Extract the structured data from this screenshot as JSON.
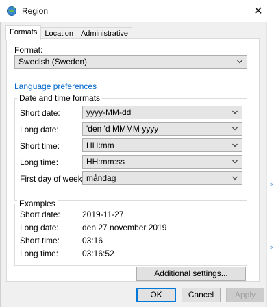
{
  "window": {
    "title": "Region",
    "close_glyph": "✕"
  },
  "tabs": [
    {
      "label": "Formats"
    },
    {
      "label": "Location"
    },
    {
      "label": "Administrative"
    }
  ],
  "format": {
    "label": "Format:",
    "value": "Swedish (Sweden)"
  },
  "language_link": "Language preferences",
  "date_time_formats": {
    "group_title": "Date and time formats",
    "short_date": {
      "label": "Short date:",
      "value": "yyyy-MM-dd"
    },
    "long_date": {
      "label": "Long date:",
      "value": "'den 'd MMMM yyyy"
    },
    "short_time": {
      "label": "Short time:",
      "value": "HH:mm"
    },
    "long_time": {
      "label": "Long time:",
      "value": "HH:mm:ss"
    },
    "first_day": {
      "label": "First day of week:",
      "value": "måndag"
    }
  },
  "examples": {
    "group_title": "Examples",
    "short_date": {
      "label": "Short date:",
      "value": "2019-11-27"
    },
    "long_date": {
      "label": "Long date:",
      "value": "den 27 november 2019"
    },
    "short_time": {
      "label": "Short time:",
      "value": "03:16"
    },
    "long_time": {
      "label": "Long time:",
      "value": "03:16:52"
    }
  },
  "buttons": {
    "additional_settings": "Additional settings...",
    "ok": "OK",
    "cancel": "Cancel",
    "apply": "Apply"
  },
  "icons": {
    "app": "region-globe-icon",
    "close": "close-icon",
    "dropdown": "chevron-down-icon"
  },
  "colors": {
    "link": "#0066cc",
    "default_button_border": "#0078d7"
  }
}
